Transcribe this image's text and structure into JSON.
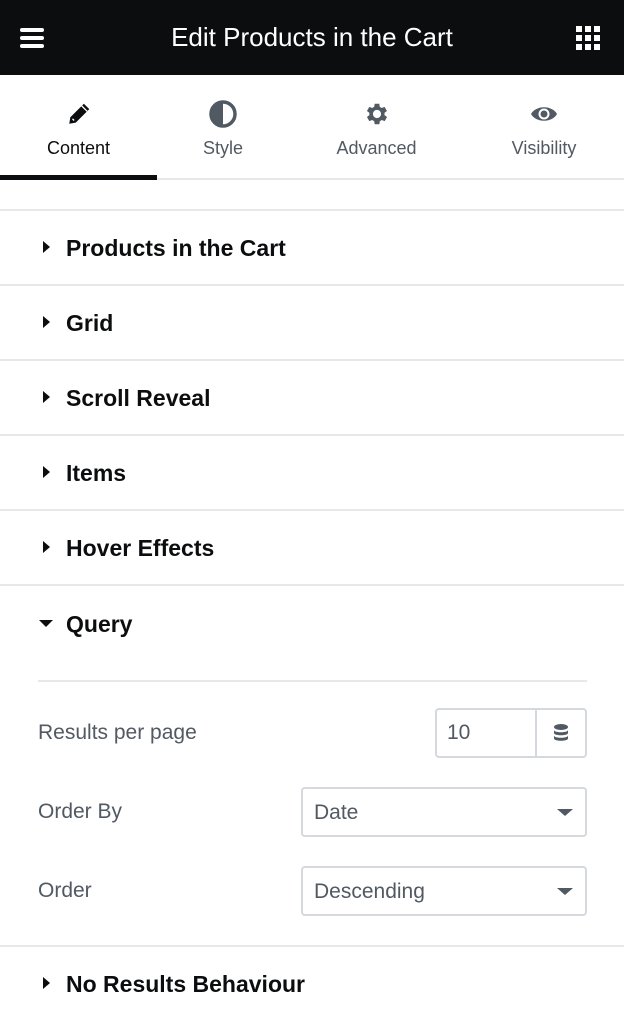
{
  "header": {
    "title": "Edit Products in the Cart",
    "menu_icon": "hamburger-menu-icon",
    "apps_icon": "grid-apps-icon"
  },
  "tabs": [
    {
      "label": "Content",
      "icon": "pencil-icon",
      "active": true
    },
    {
      "label": "Style",
      "icon": "half-circle-contrast-icon",
      "active": false
    },
    {
      "label": "Advanced",
      "icon": "gear-icon",
      "active": false
    },
    {
      "label": "Visibility",
      "icon": "eye-icon",
      "active": false
    }
  ],
  "sections": [
    {
      "label": "Products in the Cart",
      "expanded": false
    },
    {
      "label": "Grid",
      "expanded": false
    },
    {
      "label": "Scroll Reveal",
      "expanded": false
    },
    {
      "label": "Items",
      "expanded": false
    },
    {
      "label": "Hover Effects",
      "expanded": false
    },
    {
      "label": "Query",
      "expanded": true
    },
    {
      "label": "No Results Behaviour",
      "expanded": false
    }
  ],
  "query": {
    "results_per_page": {
      "label": "Results per page",
      "value": "10",
      "dynamic_icon": "database-icon"
    },
    "order_by": {
      "label": "Order By",
      "value": "Date"
    },
    "order": {
      "label": "Order",
      "value": "Descending"
    }
  },
  "colors": {
    "header_bg": "#0c0d0e",
    "text_primary": "#0c0d0e",
    "text_secondary": "#515962",
    "border": "#d5d8dc",
    "divider": "#e6e8ea"
  }
}
